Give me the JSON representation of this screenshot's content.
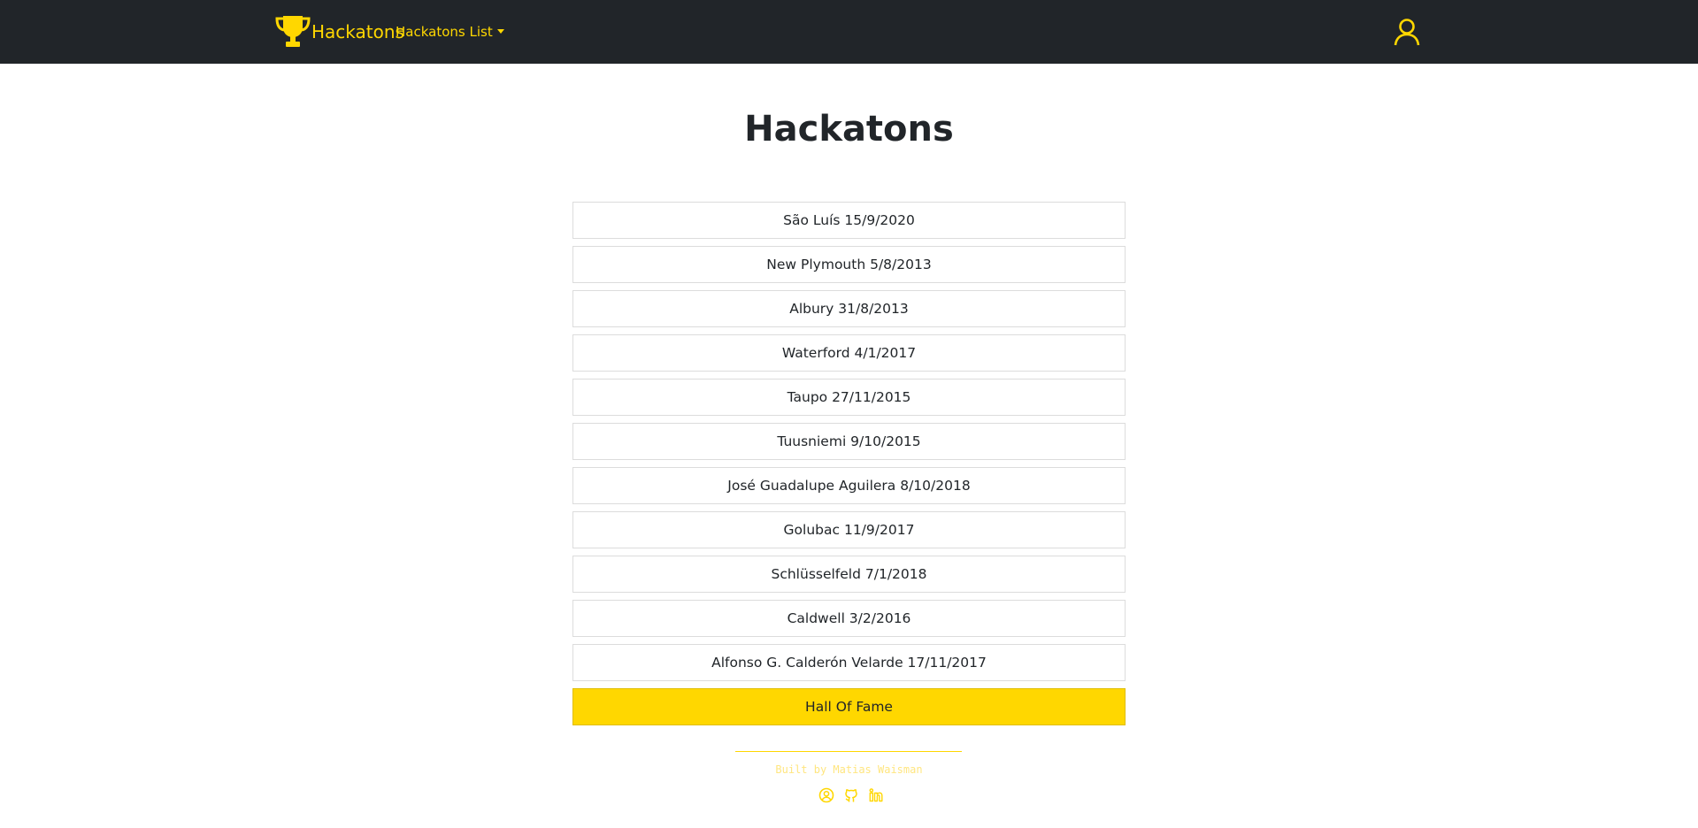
{
  "header": {
    "brand": "Hackatons",
    "dropdown_label": "Hackatons List"
  },
  "main": {
    "title": "Hackatons",
    "items": [
      {
        "label": "São Luís 15/9/2020"
      },
      {
        "label": "New Plymouth 5/8/2013"
      },
      {
        "label": "Albury 31/8/2013"
      },
      {
        "label": "Waterford 4/1/2017"
      },
      {
        "label": "Taupo 27/11/2015"
      },
      {
        "label": "Tuusniemi 9/10/2015"
      },
      {
        "label": "José Guadalupe Aguilera 8/10/2018"
      },
      {
        "label": "Golubac 11/9/2017"
      },
      {
        "label": "Schlüsselfeld 7/1/2018"
      },
      {
        "label": "Caldwell 3/2/2016"
      },
      {
        "label": "Alfonso G. Calderón Velarde 17/11/2017"
      }
    ],
    "hall_of_fame": "Hall Of Fame"
  },
  "footer": {
    "credit": "Built by Matias Waisman",
    "icons": [
      "user-circle-icon",
      "github-icon",
      "linkedin-icon"
    ]
  },
  "colors": {
    "accent": "#ffd700",
    "navbar": "#212529"
  }
}
